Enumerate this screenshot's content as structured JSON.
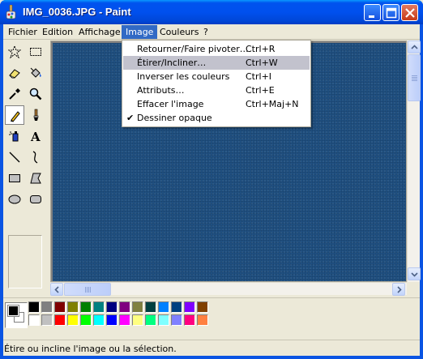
{
  "window": {
    "title": "IMG_0036.JPG - Paint"
  },
  "menubar": {
    "items": [
      "Fichier",
      "Edition",
      "Affichage",
      "Image",
      "Couleurs",
      "?"
    ],
    "active": "Image"
  },
  "image_menu": {
    "items": [
      {
        "label": "Retourner/Faire pivoter…",
        "shortcut": "Ctrl+R"
      },
      {
        "label": "Étirer/Incliner…",
        "shortcut": "Ctrl+W"
      },
      {
        "label": "Inverser les couleurs",
        "shortcut": "Ctrl+I"
      },
      {
        "label": "Attributs…",
        "shortcut": "Ctrl+E"
      },
      {
        "label": "Effacer l'image",
        "shortcut": "Ctrl+Maj+N"
      },
      {
        "label": "Dessiner opaque",
        "shortcut": "",
        "checked": true
      }
    ],
    "highlighted": "Étirer/Incliner…"
  },
  "toolbox": {
    "tools": [
      {
        "name": "free-form-select",
        "icon": "star-select-icon"
      },
      {
        "name": "select",
        "icon": "rect-select-icon"
      },
      {
        "name": "eraser",
        "icon": "eraser-icon"
      },
      {
        "name": "fill-with-color",
        "icon": "paint-bucket-icon"
      },
      {
        "name": "pick-color",
        "icon": "eyedropper-icon"
      },
      {
        "name": "magnifier",
        "icon": "magnifier-icon"
      },
      {
        "name": "pencil",
        "icon": "pencil-icon",
        "selected": true
      },
      {
        "name": "brush",
        "icon": "brush-icon"
      },
      {
        "name": "airbrush",
        "icon": "airbrush-icon"
      },
      {
        "name": "text",
        "icon": "text-icon"
      },
      {
        "name": "line",
        "icon": "line-icon"
      },
      {
        "name": "curve",
        "icon": "curve-icon"
      },
      {
        "name": "rectangle",
        "icon": "rectangle-icon"
      },
      {
        "name": "polygon",
        "icon": "polygon-icon"
      },
      {
        "name": "ellipse",
        "icon": "ellipse-icon"
      },
      {
        "name": "rounded-rectangle",
        "icon": "rounded-rect-icon"
      }
    ]
  },
  "canvas": {
    "image_color": "#1f4f80"
  },
  "palette": {
    "foreground": "#000000",
    "background": "#ffffff",
    "row1": [
      "#000000",
      "#808080",
      "#800000",
      "#808000",
      "#008000",
      "#008080",
      "#000080",
      "#800080",
      "#808040",
      "#004040",
      "#0080ff",
      "#004080",
      "#8000ff",
      "#804000"
    ],
    "row2": [
      "#ffffff",
      "#c0c0c0",
      "#ff0000",
      "#ffff00",
      "#00ff00",
      "#00ffff",
      "#0000ff",
      "#ff00ff",
      "#ffff80",
      "#00ff80",
      "#80ffff",
      "#8080ff",
      "#ff0080",
      "#ff8040"
    ]
  },
  "statusbar": {
    "text": "Étire ou incline l'image ou la sélection."
  }
}
